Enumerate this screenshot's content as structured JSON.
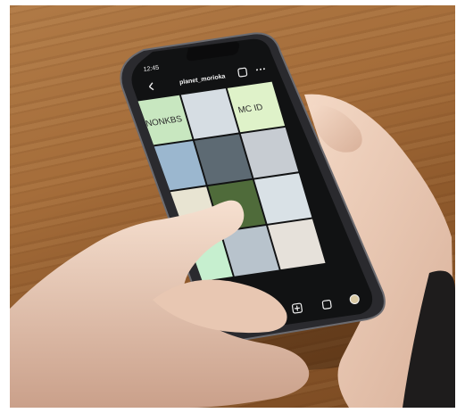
{
  "status_bar": {
    "time": "12:45"
  },
  "profile": {
    "username": "planet_morioka"
  },
  "grid_posts": [
    {
      "text": "NONKBS",
      "color": "#c8e7c0"
    },
    {
      "text": "",
      "color": "#d6dde3"
    },
    {
      "text": "MC ID",
      "color": "#dff2c9"
    },
    {
      "text": "",
      "color": "#9bb7cf"
    },
    {
      "text": "",
      "color": "#5d6a73"
    },
    {
      "text": "",
      "color": "#c7ccd2"
    },
    {
      "text": "",
      "color": "#e8e4d2"
    },
    {
      "text": "",
      "color": "#4f6b3a"
    },
    {
      "text": "",
      "color": "#d9e1e6"
    },
    {
      "text": "",
      "color": "#c6efcf"
    },
    {
      "text": "",
      "color": "#b8c3cc"
    },
    {
      "text": "",
      "color": "#e6e1da"
    }
  ],
  "icons": {
    "back": "back-arrow-icon",
    "add": "add-post-icon",
    "menu": "more-icon",
    "grid": "grid-tab-icon",
    "reels": "reels-tab-icon",
    "tagged": "tagged-tab-icon",
    "home": "home-icon",
    "search": "search-icon",
    "create": "create-icon",
    "shop": "shop-icon",
    "profile": "profile-avatar-icon"
  }
}
